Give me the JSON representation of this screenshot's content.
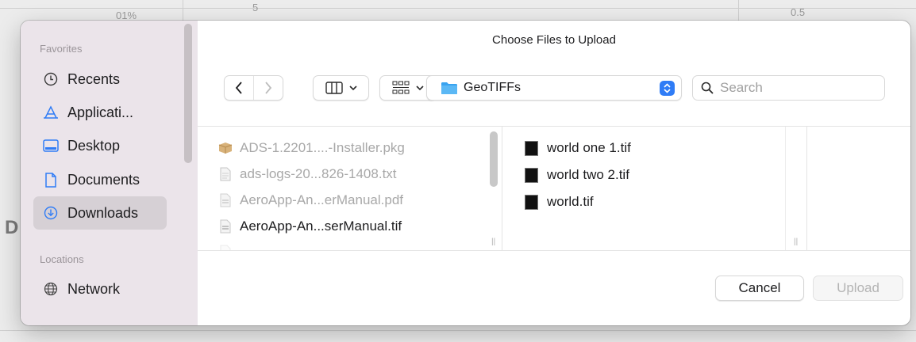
{
  "background": {
    "top_left_text": "01%",
    "top_mid_text": "5",
    "top_right_text": "0.5",
    "left_letter": "D"
  },
  "dialog": {
    "title": "Choose Files to Upload"
  },
  "sidebar": {
    "favorites_header": "Favorites",
    "locations_header": "Locations",
    "items": [
      {
        "label": "Recents",
        "icon": "clock-icon"
      },
      {
        "label": "Applicati...",
        "icon": "applications-icon"
      },
      {
        "label": "Desktop",
        "icon": "desktop-icon"
      },
      {
        "label": "Documents",
        "icon": "document-icon"
      },
      {
        "label": "Downloads",
        "icon": "download-icon",
        "selected": true
      }
    ],
    "location_items": [
      {
        "label": "Network",
        "icon": "network-globe-icon"
      }
    ]
  },
  "toolbar": {
    "location": "GeoTIFFs",
    "search_placeholder": "Search",
    "accent_color": "#2f7cf6"
  },
  "columns": {
    "downloads_files": [
      {
        "name": "ADS-1.2201....-Installer.pkg",
        "icon": "package-icon",
        "enabled": false
      },
      {
        "name": "ads-logs-20...826-1408.txt",
        "icon": "text-file-icon",
        "enabled": false
      },
      {
        "name": "AeroApp-An...erManual.pdf",
        "icon": "pdf-file-icon",
        "enabled": false
      },
      {
        "name": "AeroApp-An...serManual.tif",
        "icon": "image-file-icon",
        "enabled": true
      }
    ],
    "geotiff_files": [
      {
        "name": "world one 1.tif"
      },
      {
        "name": "world two 2.tif"
      },
      {
        "name": "world.tif"
      }
    ]
  },
  "buttons": {
    "cancel": "Cancel",
    "upload": "Upload"
  }
}
